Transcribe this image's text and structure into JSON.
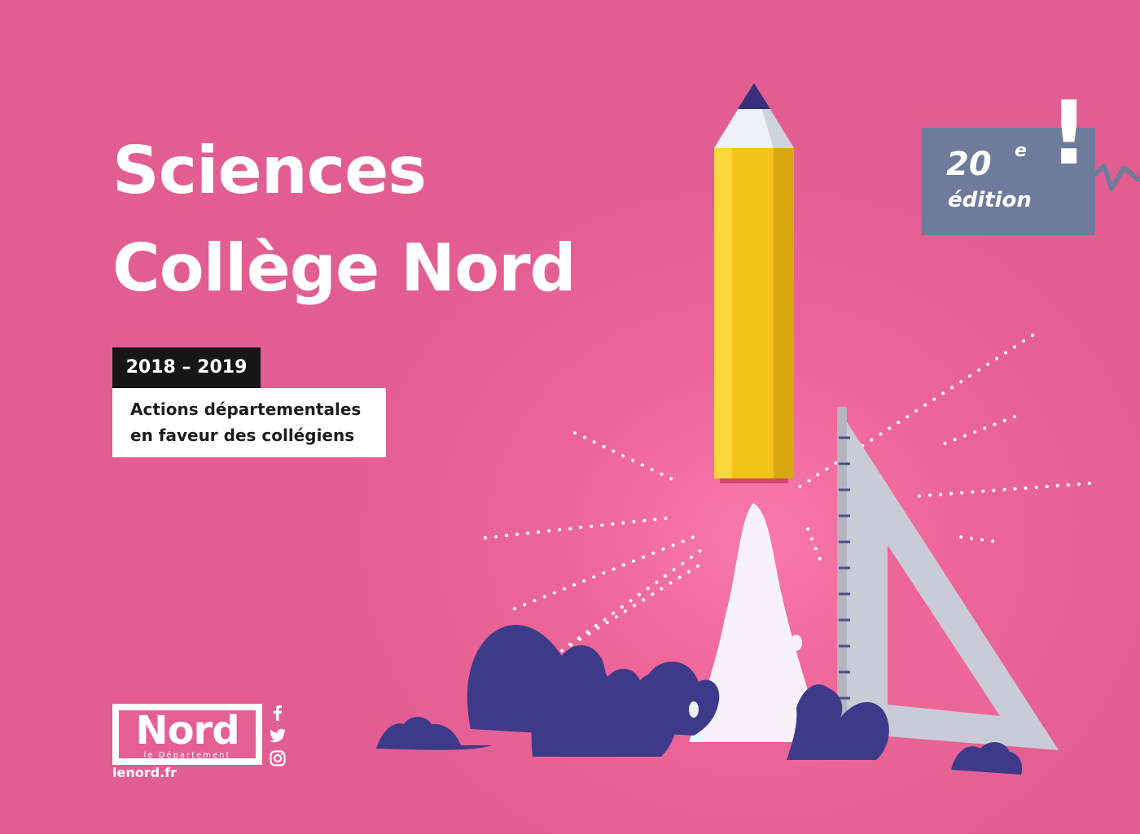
{
  "title": {
    "line1": "Sciences",
    "line2": "Collège Nord"
  },
  "years": "2018 – 2019",
  "subtitle": {
    "line1": "Actions départementales",
    "line2": "en faveur des collégiens"
  },
  "edition": {
    "number": "20",
    "suffix": "e",
    "label": "édition",
    "exclamation": "!"
  },
  "logo": {
    "word": "Nord",
    "tagline": "le Département"
  },
  "website": "lenord.fr",
  "social": [
    "facebook-icon",
    "twitter-icon",
    "instagram-icon"
  ],
  "colors": {
    "background": "#e25e92",
    "badge": "#6f7b9b",
    "pencil": "#f3c417",
    "clouds": "#3e3a8a",
    "year_badge": "#161616"
  }
}
